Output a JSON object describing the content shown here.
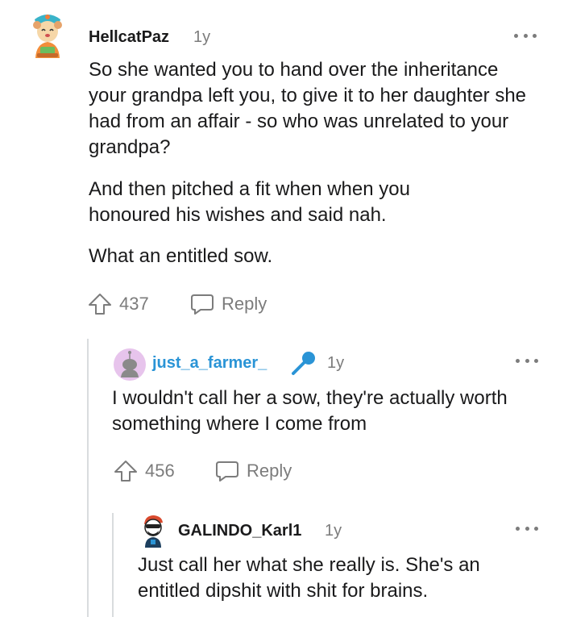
{
  "comments": [
    {
      "username": "HellcatPaz",
      "age": "1y",
      "paragraphs": [
        "So she wanted you to hand over the inheritance your grandpa left you, to give it to her daughter she had from an affair - so who was unrelated to your grandpa?",
        "And then pitched a fit when when you honoured his wishes and said nah.",
        "What an entitled sow."
      ],
      "upvotes": "437",
      "reply_label": "Reply"
    },
    {
      "username": "just_a_farmer_",
      "username_color": "#2a94d6",
      "age": "1y",
      "paragraphs": [
        "I wouldn't call her a sow, they're actually worth something where I come from"
      ],
      "upvotes": "456",
      "reply_label": "Reply"
    },
    {
      "username": "GALINDO_Karl1",
      "age": "1y",
      "paragraphs": [
        "Just call her what she really is. She's an entitled dipshit with shit for brains."
      ]
    }
  ],
  "icons": {
    "more": "more-options-icon",
    "upvote": "upvote-arrow-icon",
    "reply": "reply-bubble-icon",
    "flair": "microphone-icon"
  },
  "colors": {
    "text": "#1a1a1b",
    "muted": "#7c7c7c",
    "link_username": "#2a94d6",
    "thread_line": "#d9dcde"
  }
}
